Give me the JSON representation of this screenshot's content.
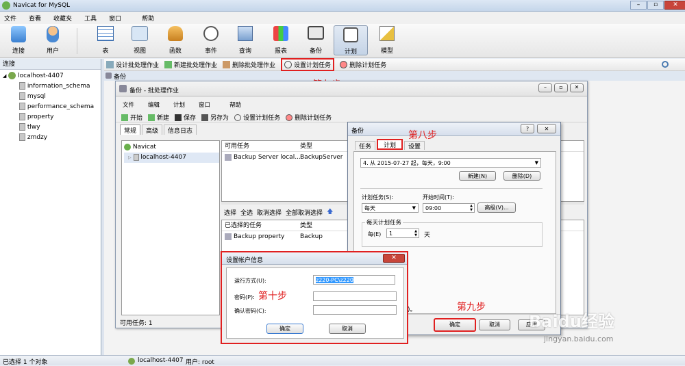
{
  "app": {
    "title": "Navicat for MySQL"
  },
  "menubar": [
    "文件",
    "查看",
    "收藏夹",
    "工具",
    "窗口",
    "帮助"
  ],
  "toolbar": [
    {
      "label": "连接",
      "icon": "plug-icon"
    },
    {
      "label": "用户",
      "icon": "user-icon"
    },
    {
      "label": "表",
      "icon": "table-icon"
    },
    {
      "label": "视图",
      "icon": "view-icon"
    },
    {
      "label": "函数",
      "icon": "function-icon"
    },
    {
      "label": "事件",
      "icon": "event-icon"
    },
    {
      "label": "查询",
      "icon": "query-icon"
    },
    {
      "label": "报表",
      "icon": "report-icon"
    },
    {
      "label": "备份",
      "icon": "backup-icon"
    },
    {
      "label": "计划",
      "icon": "schedule-icon"
    },
    {
      "label": "模型",
      "icon": "model-icon"
    }
  ],
  "conn_header": "连接",
  "subtoolbar": [
    "设计批处理作业",
    "新建批处理作业",
    "删除批处理作业",
    "设置计划任务",
    "删除计划任务"
  ],
  "tree": {
    "root": "localhost-4407",
    "items": [
      "information_schema",
      "mysql",
      "performance_schema",
      "property",
      "tlwy",
      "zmdzy"
    ]
  },
  "tab_title": "备份",
  "batch": {
    "title": "备份 - 批处理作业",
    "menu": [
      "文件",
      "编辑",
      "计划",
      "窗口",
      "帮助"
    ],
    "toolbar": [
      "开始",
      "新建",
      "保存",
      "另存为",
      "设置计划任务",
      "删除计划任务"
    ],
    "tabs": [
      "常规",
      "高级",
      "信息日志"
    ],
    "tree": [
      "Navicat",
      "localhost-4407"
    ],
    "available_header": [
      "可用任务",
      "类型"
    ],
    "available_rows": [
      [
        "Backup Server local...",
        "BackupServer"
      ]
    ],
    "select_bar": [
      "选择",
      "全选",
      "取消选择",
      "全部取消选择"
    ],
    "selected_header": [
      "已选择的任务",
      "类型"
    ],
    "selected_rows": [
      [
        "Backup property",
        "Backup"
      ]
    ],
    "status": "可用任务: 1"
  },
  "sched": {
    "title": "备份",
    "tabs": [
      "任务",
      "计划",
      "设置"
    ],
    "schedule_value": "4. 从 2015-07-27 起，每天，9:00",
    "new_btn": "新建(N)",
    "delete_btn": "删除(D)",
    "task_label": "计划任务(S):",
    "start_label": "开始时间(T):",
    "task_value": "每天",
    "time_value": "09:00",
    "advanced_btn": "高级(V)...",
    "group_label": "每天计划任务",
    "every_label": "每(E)",
    "every_value": "1",
    "day_label": "天",
    "ok_btn": "确定",
    "cancel_btn": "取消",
    "apply_btn": "应用",
    "trail_text": ")。"
  },
  "account": {
    "title": "设置帐户信息",
    "run_label": "运行方式(U):",
    "run_value": "z220-PC\\z220",
    "pwd_label": "密码(P):",
    "confirm_label": "确认密码(C):",
    "ok_btn": "确定",
    "cancel_btn": "取消"
  },
  "annotations": {
    "step7": "第七步",
    "step8": "第八步",
    "step9": "第九步",
    "step10": "第十步"
  },
  "statusbar": {
    "left": "已选择 1 个对象",
    "conn": "localhost-4407",
    "user": "用户: root"
  },
  "watermark": {
    "brand": "Baidu经验",
    "url": "jingyan.baidu.com"
  },
  "colors": {
    "accent": "#e02020",
    "title_bar": "#c9d9ec",
    "selection": "#3399ff"
  }
}
